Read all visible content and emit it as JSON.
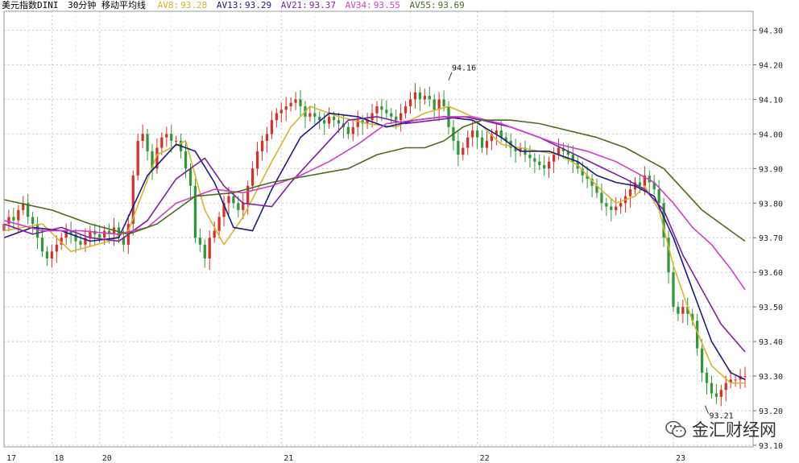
{
  "header": {
    "symbol": "美元指数DINI",
    "period": "30分钟 移动平均线",
    "ma": [
      {
        "label": "AV8:",
        "value": "93.28",
        "color": "#d4b62a"
      },
      {
        "label": "AV13:",
        "value": "93.29",
        "color": "#1a1a8a"
      },
      {
        "label": "AV21:",
        "value": "93.37",
        "color": "#7a1fa0"
      },
      {
        "label": "AV34:",
        "value": "93.55",
        "color": "#d43cc6"
      },
      {
        "label": "AV55:",
        "value": "93.69",
        "color": "#4b6b1c"
      }
    ]
  },
  "watermark": {
    "text": "金汇财经网",
    "icon": "wechat-icon"
  },
  "chart_data": {
    "type": "line",
    "title": "美元指数DINI 30分钟 移动平均线",
    "ylim": [
      93.1,
      94.35
    ],
    "yticks": [
      "94.30",
      "94.20",
      "94.10",
      "94.00",
      "93.90",
      "93.80",
      "93.70",
      "93.60",
      "93.50",
      "93.40",
      "93.30",
      "93.20",
      "93.10"
    ],
    "yticks_num": [
      94.3,
      94.2,
      94.1,
      94.0,
      93.9,
      93.8,
      93.7,
      93.6,
      93.5,
      93.4,
      93.3,
      93.2,
      93.1
    ],
    "xlim": [
      0,
      155
    ],
    "xticks": [
      {
        "label": "17",
        "x": 0
      },
      {
        "label": "18",
        "x": 10
      },
      {
        "label": "20",
        "x": 20
      },
      {
        "label": "21",
        "x": 58
      },
      {
        "label": "22",
        "x": 99
      },
      {
        "label": "23",
        "x": 140
      }
    ],
    "grid": true,
    "annotations": [
      {
        "text": "94.16",
        "x": 93,
        "y": 94.16
      },
      {
        "text": "93.21",
        "x": 147,
        "y": 93.21
      }
    ],
    "candles": {
      "open": [
        93.72,
        93.74,
        93.76,
        93.75,
        93.78,
        93.8,
        93.76,
        93.74,
        93.7,
        93.66,
        93.64,
        93.66,
        93.68,
        93.7,
        93.72,
        93.71,
        93.69,
        93.68,
        93.7,
        93.72,
        93.71,
        93.7,
        93.72,
        93.71,
        93.73,
        93.7,
        93.68,
        93.74,
        93.88,
        93.98,
        94.0,
        93.95,
        93.9,
        93.96,
        93.99,
        94.0,
        93.98,
        93.98,
        93.95,
        93.9,
        93.85,
        93.7,
        93.68,
        93.64,
        93.7,
        93.72,
        93.76,
        93.8,
        93.82,
        93.8,
        93.78,
        93.8,
        93.85,
        93.9,
        93.95,
        93.98,
        94.0,
        94.04,
        94.06,
        94.07,
        94.08,
        94.09,
        94.1,
        94.08,
        94.05,
        94.06,
        94.05,
        94.04,
        94.03,
        94.05,
        94.04,
        94.03,
        94.02,
        94.0,
        94.02,
        94.04,
        94.03,
        94.04,
        94.06,
        94.08,
        94.07,
        94.06,
        94.05,
        94.04,
        94.06,
        94.08,
        94.1,
        94.12,
        94.1,
        94.11,
        94.1,
        94.07,
        94.1,
        94.08,
        94.02,
        93.98,
        93.94,
        93.96,
        93.99,
        94.01,
        93.99,
        93.96,
        93.98,
        94.0,
        94.01,
        93.99,
        93.98,
        93.96,
        93.95,
        93.96,
        93.94,
        93.93,
        93.92,
        93.91,
        93.9,
        93.92,
        93.94,
        93.96,
        93.95,
        93.94,
        93.92,
        93.9,
        93.88,
        93.87,
        93.85,
        93.83,
        93.8,
        93.79,
        93.78,
        93.79,
        93.8,
        93.82,
        93.84,
        93.86,
        93.85,
        93.88,
        93.86,
        93.84,
        93.8,
        93.7,
        93.6,
        93.5,
        93.48,
        93.5,
        93.48,
        93.46,
        93.38,
        93.31,
        93.28,
        93.25,
        93.24,
        93.26,
        93.28,
        93.29,
        93.29,
        93.3
      ],
      "close": [
        93.74,
        93.76,
        93.75,
        93.78,
        93.8,
        93.76,
        93.74,
        93.7,
        93.66,
        93.64,
        93.66,
        93.68,
        93.7,
        93.72,
        93.71,
        93.69,
        93.68,
        93.7,
        93.72,
        93.71,
        93.7,
        93.72,
        93.71,
        93.73,
        93.7,
        93.68,
        93.74,
        93.88,
        93.98,
        94.0,
        93.95,
        93.9,
        93.96,
        93.99,
        94.0,
        93.98,
        93.98,
        93.95,
        93.9,
        93.85,
        93.7,
        93.68,
        93.64,
        93.7,
        93.72,
        93.76,
        93.8,
        93.82,
        93.8,
        93.78,
        93.8,
        93.85,
        93.9,
        93.95,
        93.98,
        94.0,
        94.04,
        94.06,
        94.07,
        94.08,
        94.09,
        94.1,
        94.08,
        94.05,
        94.06,
        94.05,
        94.04,
        94.03,
        94.05,
        94.04,
        94.03,
        94.02,
        94.0,
        94.02,
        94.04,
        94.03,
        94.04,
        94.06,
        94.08,
        94.07,
        94.06,
        94.05,
        94.04,
        94.06,
        94.08,
        94.1,
        94.12,
        94.1,
        94.11,
        94.1,
        94.07,
        94.1,
        94.08,
        94.02,
        93.98,
        93.94,
        93.96,
        93.99,
        94.01,
        93.99,
        93.96,
        93.98,
        94.0,
        94.01,
        93.99,
        93.98,
        93.96,
        93.95,
        93.96,
        93.94,
        93.93,
        93.92,
        93.91,
        93.9,
        93.92,
        93.94,
        93.96,
        93.95,
        93.94,
        93.92,
        93.9,
        93.88,
        93.87,
        93.85,
        93.83,
        93.8,
        93.79,
        93.78,
        93.79,
        93.8,
        93.82,
        93.84,
        93.86,
        93.85,
        93.88,
        93.86,
        93.84,
        93.8,
        93.7,
        93.6,
        93.5,
        93.48,
        93.5,
        93.48,
        93.46,
        93.38,
        93.31,
        93.28,
        93.25,
        93.24,
        93.26,
        93.28,
        93.29,
        93.29,
        93.3,
        93.3
      ]
    },
    "series": [
      {
        "name": "AV8",
        "color": "#d4b62a",
        "points": [
          [
            0,
            93.72
          ],
          [
            8,
            93.74
          ],
          [
            14,
            93.66
          ],
          [
            22,
            93.69
          ],
          [
            26,
            93.72
          ],
          [
            32,
            93.94
          ],
          [
            38,
            93.98
          ],
          [
            42,
            93.78
          ],
          [
            46,
            93.68
          ],
          [
            50,
            93.76
          ],
          [
            56,
            93.92
          ],
          [
            60,
            94.02
          ],
          [
            64,
            94.08
          ],
          [
            70,
            94.05
          ],
          [
            76,
            94.03
          ],
          [
            82,
            94.02
          ],
          [
            88,
            94.06
          ],
          [
            93,
            94.08
          ],
          [
            98,
            94.05
          ],
          [
            104,
            93.97
          ],
          [
            108,
            93.96
          ],
          [
            112,
            93.95
          ],
          [
            116,
            93.94
          ],
          [
            120,
            93.91
          ],
          [
            124,
            93.85
          ],
          [
            128,
            93.8
          ],
          [
            132,
            93.82
          ],
          [
            134,
            93.85
          ],
          [
            137,
            93.78
          ],
          [
            140,
            93.62
          ],
          [
            144,
            93.46
          ],
          [
            148,
            93.33
          ],
          [
            152,
            93.28
          ],
          [
            155,
            93.28
          ]
        ]
      },
      {
        "name": "AV13",
        "color": "#1a1a8a",
        "points": [
          [
            0,
            93.7
          ],
          [
            6,
            93.73
          ],
          [
            12,
            93.72
          ],
          [
            18,
            93.69
          ],
          [
            24,
            93.7
          ],
          [
            30,
            93.88
          ],
          [
            36,
            93.97
          ],
          [
            40,
            93.95
          ],
          [
            44,
            93.86
          ],
          [
            48,
            93.73
          ],
          [
            52,
            93.72
          ],
          [
            56,
            93.84
          ],
          [
            62,
            93.99
          ],
          [
            68,
            94.06
          ],
          [
            74,
            94.05
          ],
          [
            80,
            94.02
          ],
          [
            86,
            94.04
          ],
          [
            92,
            94.05
          ],
          [
            98,
            94.04
          ],
          [
            104,
            93.99
          ],
          [
            108,
            93.95
          ],
          [
            114,
            93.95
          ],
          [
            120,
            93.92
          ],
          [
            124,
            93.88
          ],
          [
            128,
            93.86
          ],
          [
            132,
            93.85
          ],
          [
            136,
            93.82
          ],
          [
            140,
            93.7
          ],
          [
            144,
            93.55
          ],
          [
            148,
            93.4
          ],
          [
            152,
            93.31
          ],
          [
            155,
            93.29
          ]
        ]
      },
      {
        "name": "AV21",
        "color": "#7a1fa0",
        "points": [
          [
            0,
            93.74
          ],
          [
            6,
            93.71
          ],
          [
            12,
            93.73
          ],
          [
            18,
            93.7
          ],
          [
            24,
            93.69
          ],
          [
            30,
            93.75
          ],
          [
            36,
            93.87
          ],
          [
            42,
            93.93
          ],
          [
            46,
            93.85
          ],
          [
            50,
            93.8
          ],
          [
            56,
            93.79
          ],
          [
            60,
            93.86
          ],
          [
            66,
            93.95
          ],
          [
            72,
            94.04
          ],
          [
            78,
            94.05
          ],
          [
            84,
            94.03
          ],
          [
            90,
            94.04
          ],
          [
            96,
            94.05
          ],
          [
            100,
            94.04
          ],
          [
            106,
            94.02
          ],
          [
            112,
            93.99
          ],
          [
            118,
            93.95
          ],
          [
            124,
            93.91
          ],
          [
            130,
            93.87
          ],
          [
            134,
            93.84
          ],
          [
            138,
            93.78
          ],
          [
            142,
            93.65
          ],
          [
            146,
            93.55
          ],
          [
            150,
            93.45
          ],
          [
            155,
            93.37
          ]
        ]
      },
      {
        "name": "AV34",
        "color": "#d43cc6",
        "points": [
          [
            0,
            93.75
          ],
          [
            8,
            93.72
          ],
          [
            16,
            93.72
          ],
          [
            24,
            93.71
          ],
          [
            30,
            93.73
          ],
          [
            36,
            93.8
          ],
          [
            44,
            93.84
          ],
          [
            50,
            93.83
          ],
          [
            56,
            93.85
          ],
          [
            62,
            93.88
          ],
          [
            68,
            93.92
          ],
          [
            74,
            93.97
          ],
          [
            80,
            94.03
          ],
          [
            86,
            94.04
          ],
          [
            92,
            94.05
          ],
          [
            98,
            94.05
          ],
          [
            104,
            94.03
          ],
          [
            110,
            94.0
          ],
          [
            116,
            93.97
          ],
          [
            122,
            93.95
          ],
          [
            128,
            93.92
          ],
          [
            132,
            93.89
          ],
          [
            136,
            93.86
          ],
          [
            140,
            93.8
          ],
          [
            144,
            93.73
          ],
          [
            148,
            93.68
          ],
          [
            152,
            93.61
          ],
          [
            155,
            93.55
          ]
        ]
      },
      {
        "name": "AV55",
        "color": "#4b6b1c",
        "points": [
          [
            0,
            93.81
          ],
          [
            10,
            93.78
          ],
          [
            18,
            93.74
          ],
          [
            26,
            93.71
          ],
          [
            32,
            93.74
          ],
          [
            40,
            93.82
          ],
          [
            48,
            93.83
          ],
          [
            56,
            93.86
          ],
          [
            64,
            93.88
          ],
          [
            72,
            93.9
          ],
          [
            78,
            93.94
          ],
          [
            84,
            93.96
          ],
          [
            88,
            93.96
          ],
          [
            92,
            93.98
          ],
          [
            96,
            94.02
          ],
          [
            100,
            94.04
          ],
          [
            106,
            94.04
          ],
          [
            112,
            94.03
          ],
          [
            118,
            94.01
          ],
          [
            124,
            93.99
          ],
          [
            130,
            93.96
          ],
          [
            134,
            93.93
          ],
          [
            138,
            93.9
          ],
          [
            142,
            93.84
          ],
          [
            146,
            93.78
          ],
          [
            150,
            93.74
          ],
          [
            155,
            93.69
          ]
        ]
      }
    ]
  }
}
